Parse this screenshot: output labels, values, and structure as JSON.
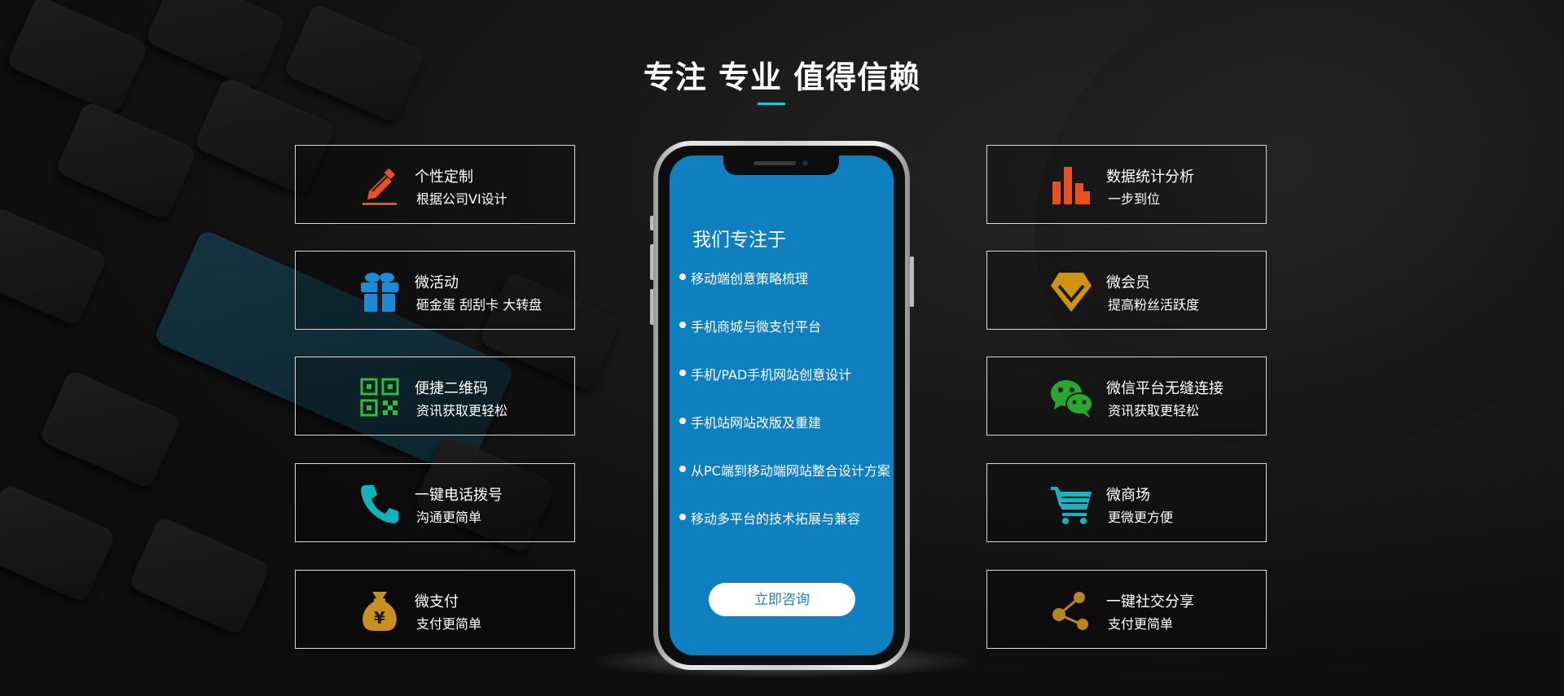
{
  "header": {
    "title": "专注 专业 值得信赖"
  },
  "features_left": [
    {
      "icon": "pencil-icon",
      "color": "#e8501f",
      "title": "个性定制",
      "subtitle": "根据公司VI设计"
    },
    {
      "icon": "gift-icon",
      "color": "#1a8bd6",
      "title": "微活动",
      "subtitle": "砸金蛋 刮刮卡 大转盘"
    },
    {
      "icon": "qrcode-icon",
      "color": "#2bbf3a",
      "title": "便捷二维码",
      "subtitle": "资讯获取更轻松"
    },
    {
      "icon": "phone-icon",
      "color": "#0fb3b8",
      "title": "一键电话拨号",
      "subtitle": "沟通更简单"
    },
    {
      "icon": "money-bag-icon",
      "color": "#c8901c",
      "title": "微支付",
      "subtitle": "支付更简单",
      "icon_text": "¥"
    }
  ],
  "features_right": [
    {
      "icon": "bar-chart-icon",
      "color": "#e8501f",
      "title": "数据统计分析",
      "subtitle": "一步到位"
    },
    {
      "icon": "diamond-icon",
      "color": "#d2920e",
      "title": "微会员",
      "subtitle": "提高粉丝活跃度"
    },
    {
      "icon": "wechat-icon",
      "color": "#2aa52f",
      "title": "微信平台无缝连接",
      "subtitle": "资讯获取更轻松"
    },
    {
      "icon": "cart-icon",
      "color": "#1ab2c2",
      "title": "微商场",
      "subtitle": "更微更方便"
    },
    {
      "icon": "share-icon",
      "color": "#b88620",
      "title": "一键社交分享",
      "subtitle": "支付更简单"
    }
  ],
  "phone": {
    "heading": "我们专注于",
    "items": [
      "移动端创意策略梳理",
      "手机商城与微支付平台",
      "手机/PAD手机网站创意设计",
      "手机站网站改版及重建",
      "从PC端到移动端网站整合设计方案",
      "移动多平台的技术拓展与兼容"
    ],
    "button_label": "立即咨询"
  },
  "colors": {
    "accent": "#1ec3d6",
    "screen": "#0e7fbf"
  }
}
